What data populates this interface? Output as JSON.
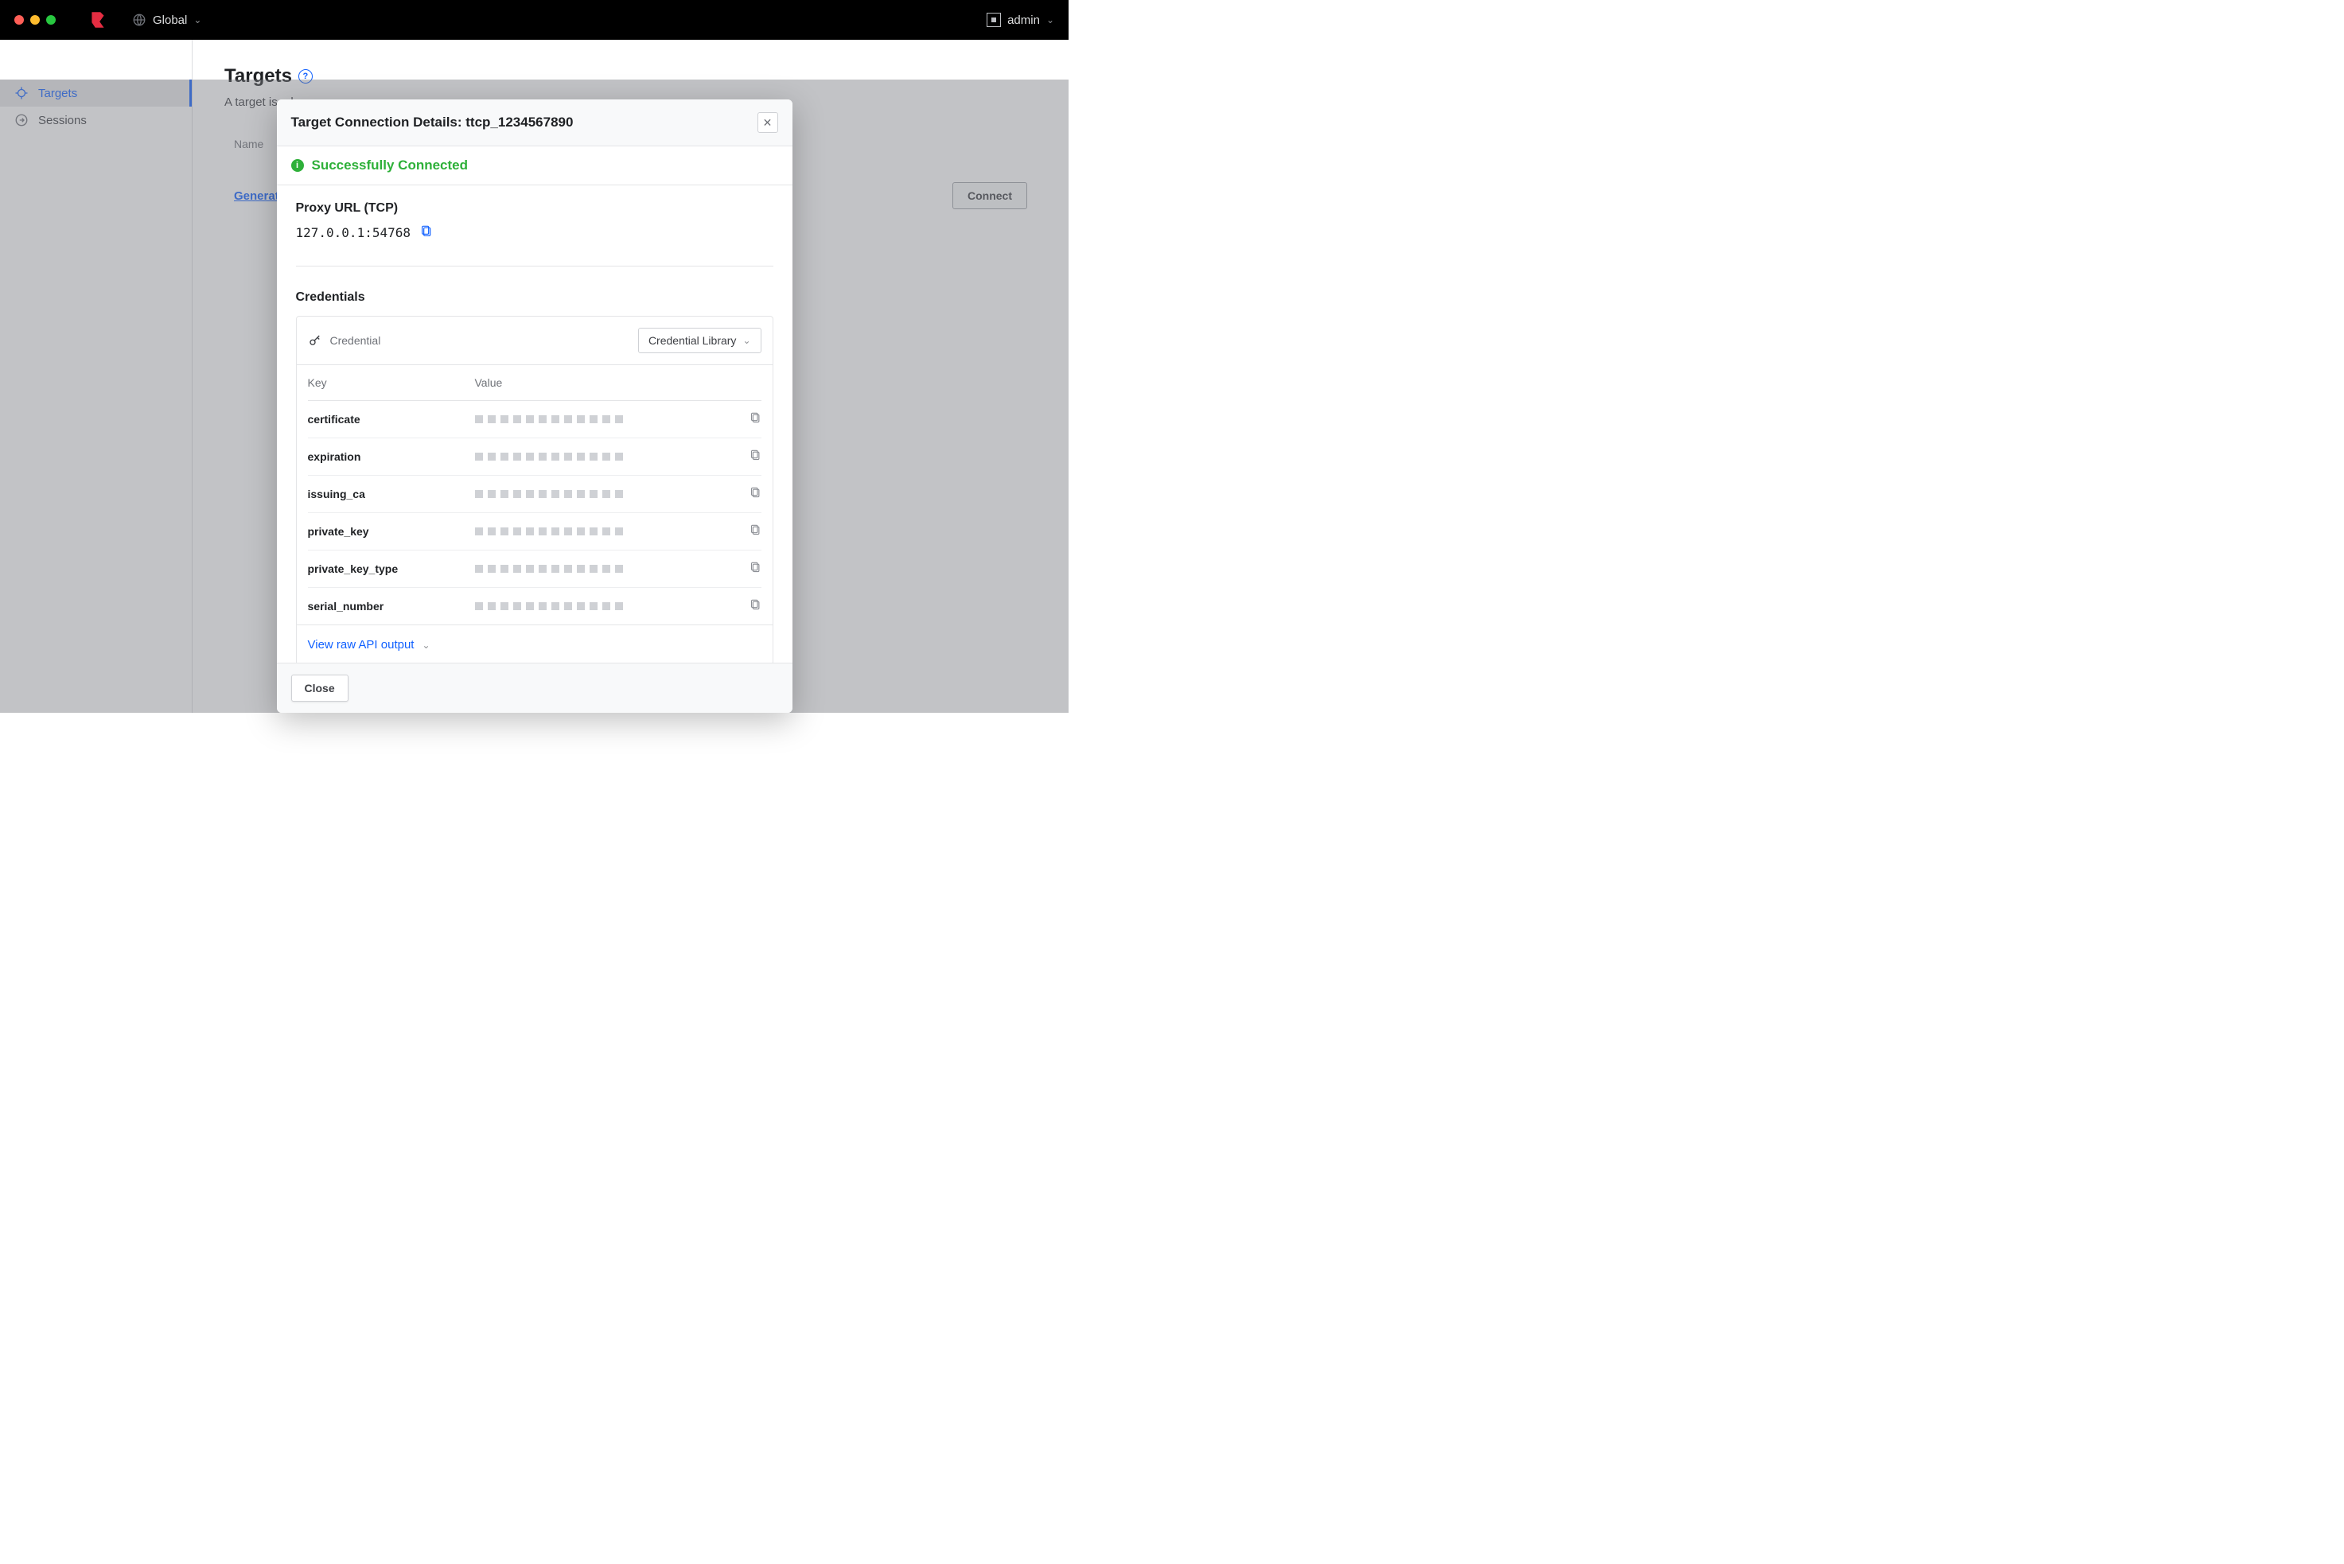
{
  "topbar": {
    "scope_label": "Global",
    "user_label": "admin"
  },
  "sidebar": {
    "items": [
      {
        "label": "Targets",
        "active": true
      },
      {
        "label": "Sessions",
        "active": false
      }
    ]
  },
  "page": {
    "title": "Targets",
    "subtitle_prefix": "A target is a l",
    "table": {
      "name_header": "Name",
      "rows": [
        {
          "name_prefix": "Generated t",
          "action_label": "Connect"
        }
      ]
    }
  },
  "modal": {
    "title_prefix": "Target Connection Details: ",
    "title_target": "ttcp_1234567890",
    "status_text": "Successfully Connected",
    "proxy_section_title": "Proxy URL (TCP)",
    "proxy_url": "127.0.0.1:54768",
    "credentials_title": "Credentials",
    "credential_label": "Credential",
    "credential_library_label": "Credential Library",
    "columns": {
      "key": "Key",
      "value": "Value"
    },
    "rows": [
      {
        "key": "certificate"
      },
      {
        "key": "expiration"
      },
      {
        "key": "issuing_ca"
      },
      {
        "key": "private_key"
      },
      {
        "key": "private_key_type"
      },
      {
        "key": "serial_number"
      }
    ],
    "raw_api_link": "View raw API output",
    "close_button": "Close"
  }
}
